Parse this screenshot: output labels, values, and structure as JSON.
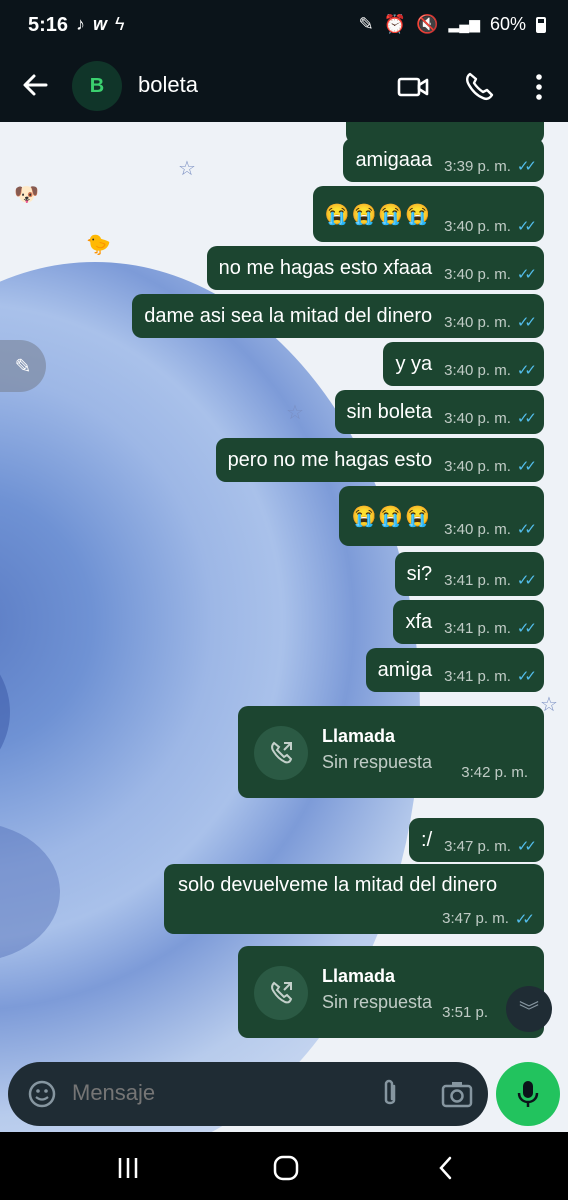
{
  "status": {
    "time": "5:16",
    "battery": "60%"
  },
  "header": {
    "avatar_letter": "B",
    "name": "boleta"
  },
  "messages": [
    {
      "text": "amigaaa",
      "time": "3:39 p. m."
    },
    {
      "text": "😭😭😭😭",
      "time": "3:40 p. m."
    },
    {
      "text": "no me hagas esto xfaaa",
      "time": "3:40 p. m."
    },
    {
      "text": "dame asi sea la mitad del dinero",
      "time": "3:40 p. m."
    },
    {
      "text": "y ya",
      "time": "3:40 p. m."
    },
    {
      "text": "sin boleta",
      "time": "3:40 p. m."
    },
    {
      "text": "pero no me hagas esto",
      "time": "3:40 p. m."
    },
    {
      "text": "😭😭😭",
      "time": "3:40 p. m."
    },
    {
      "text": "si?",
      "time": "3:41 p. m."
    },
    {
      "text": "xfa",
      "time": "3:41 p. m."
    },
    {
      "text": "amiga",
      "time": "3:41 p. m."
    },
    {
      "text": ":/",
      "time": "3:47 p. m."
    },
    {
      "text": "solo devuelveme la mitad del dinero",
      "time": "3:47 p. m."
    }
  ],
  "calls": [
    {
      "title": "Llamada",
      "subtitle": "Sin respuesta",
      "time": "3:42 p. m."
    },
    {
      "title": "Llamada",
      "subtitle": "Sin respuesta",
      "time": "3:51 p."
    }
  ],
  "input": {
    "placeholder": "Mensaje"
  },
  "colors": {
    "bubble": "#1c4530",
    "ticks": "#53bdeb",
    "mic": "#22c35e"
  }
}
